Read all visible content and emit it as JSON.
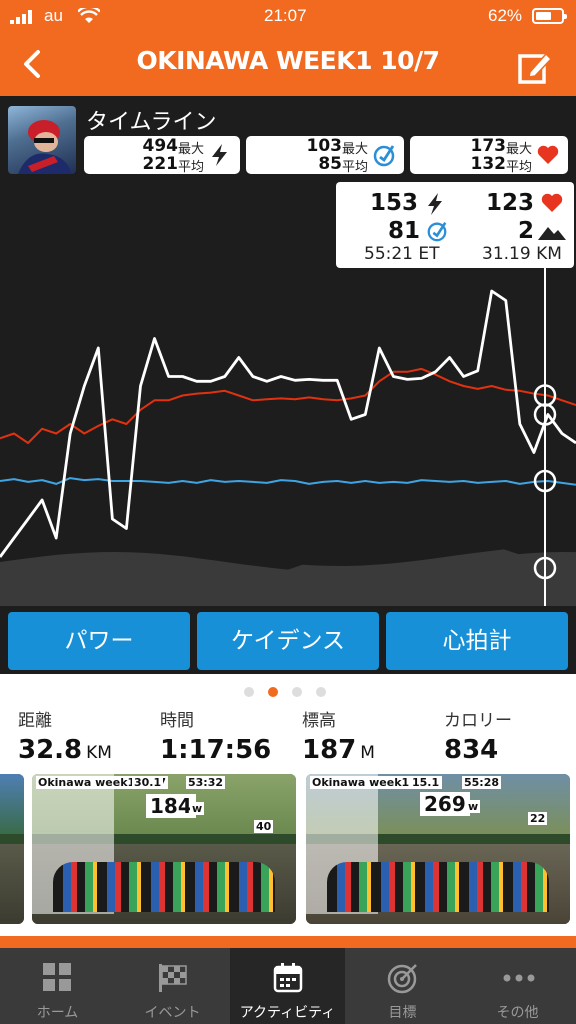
{
  "status_bar": {
    "carrier": "au",
    "time": "21:07",
    "battery": "62%",
    "battery_level": 0.62
  },
  "header": {
    "title": "OKINAWA WEEK1 10/7",
    "back_icon": "chevron-left-icon",
    "edit_icon": "edit-icon"
  },
  "timeline": {
    "title": "タイムライン",
    "stats": [
      {
        "max": "494",
        "avg": "221",
        "max_label": "最大",
        "avg_label": "平均",
        "icon": "lightning-icon"
      },
      {
        "max": "103",
        "avg": "85",
        "max_label": "最大",
        "avg_label": "平均",
        "icon": "cadence-icon"
      },
      {
        "max": "173",
        "avg": "132",
        "max_label": "最大",
        "avg_label": "平均",
        "icon": "heart-icon"
      }
    ],
    "tooltip": {
      "power": "153",
      "hr": "123",
      "cadence": "81",
      "elevation": "2",
      "time": "55:21 ET",
      "distance": "31.19 KM"
    }
  },
  "chart_data": {
    "type": "line",
    "series": [
      {
        "color": "#e1320f",
        "values": [
          145,
          150,
          140,
          155,
          150,
          160,
          150,
          158,
          165,
          160,
          175,
          185,
          185,
          190,
          192,
          193,
          195,
          190,
          185,
          186,
          187,
          186,
          188,
          186,
          185,
          187,
          190,
          205,
          215,
          215,
          218,
          212,
          205,
          200,
          197,
          200,
          196,
          195,
          192,
          190,
          185,
          180
        ]
      },
      {
        "color": "#3fa4e3",
        "values": [
          100,
          102,
          99,
          101,
          97,
          103,
          101,
          102,
          100,
          100,
          100,
          99,
          98,
          100,
          98,
          101,
          99,
          100,
          99,
          98,
          101,
          100,
          97,
          99,
          100,
          98,
          100,
          98,
          99,
          98,
          101,
          100,
          99,
          100,
          98,
          99,
          100,
          97,
          99,
          100,
          98,
          96
        ]
      },
      {
        "color": "#ffffff",
        "values": [
          20,
          40,
          60,
          80,
          40,
          150,
          200,
          240,
          60,
          50,
          200,
          250,
          210,
          210,
          205,
          205,
          210,
          230,
          210,
          205,
          210,
          206,
          207,
          206,
          206,
          165,
          170,
          240,
          210,
          207,
          208,
          215,
          230,
          210,
          216,
          300,
          290,
          160,
          130,
          170,
          150,
          140
        ]
      }
    ],
    "colors": {
      "power": "#ffffff",
      "cadence": "#3fa4e3",
      "heart_rate": "#e1320f"
    }
  },
  "buttons": [
    {
      "label": "パワー"
    },
    {
      "label": "ケイデンス"
    },
    {
      "label": "心拍計"
    }
  ],
  "page_dots": {
    "count": 4,
    "active": 1
  },
  "metrics": [
    {
      "label": "距離",
      "value": "32.8",
      "unit": "KM"
    },
    {
      "label": "時間",
      "value": "1:17:56",
      "unit": ""
    },
    {
      "label": "標高",
      "value": "187",
      "unit": "M"
    },
    {
      "label": "カロリー",
      "value": "834",
      "unit": ""
    }
  ],
  "screenshots": [
    {
      "watts": "184",
      "unit": "w",
      "speed": "30.1",
      "time": "53:32",
      "header": "Okinawa week1 10/7",
      "gap": "40"
    },
    {
      "watts": "269",
      "unit": "w",
      "speed": "15.1",
      "time": "55:28",
      "header": "Okinawa week1 10/7",
      "gap": "22"
    }
  ],
  "tabs": [
    {
      "label": "ホーム",
      "icon": "grid-icon"
    },
    {
      "label": "イベント",
      "icon": "checkered-flag-icon"
    },
    {
      "label": "アクティビティ",
      "icon": "calendar-icon",
      "active": true
    },
    {
      "label": "目標",
      "icon": "target-icon"
    },
    {
      "label": "その他",
      "icon": "more-icon"
    }
  ]
}
